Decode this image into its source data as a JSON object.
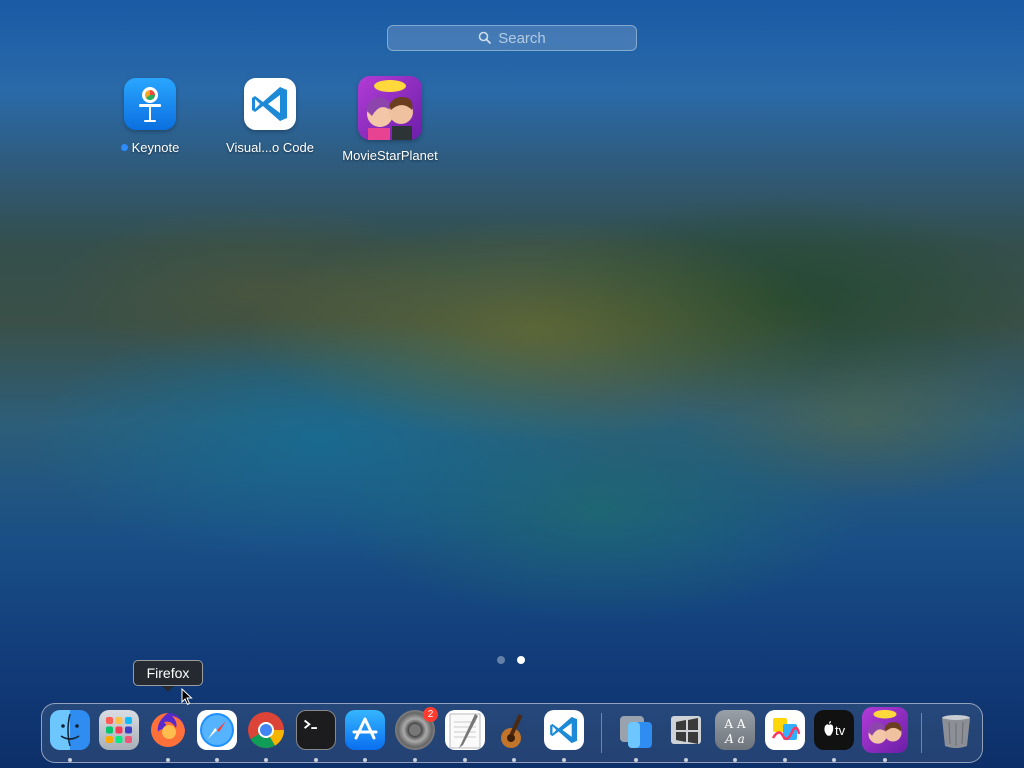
{
  "search": {
    "placeholder": "Search"
  },
  "apps": [
    {
      "label": "Keynote",
      "icon": "keynote-icon",
      "new": true
    },
    {
      "label": "Visual...o Code",
      "icon": "vscode-icon"
    },
    {
      "label": "MovieStarPlanet",
      "icon": "moviestarplanet-icon"
    }
  ],
  "pager": {
    "pages": 2,
    "current": 2
  },
  "tooltip": {
    "text": "Firefox"
  },
  "dock": {
    "items": [
      {
        "name": "Finder",
        "icon": "finder-icon",
        "running": true
      },
      {
        "name": "Launchpad",
        "icon": "launchpad-icon",
        "running": false
      },
      {
        "name": "Firefox",
        "icon": "firefox-icon",
        "running": true
      },
      {
        "name": "Safari",
        "icon": "safari-icon",
        "running": true
      },
      {
        "name": "Google Chrome",
        "icon": "chrome-icon",
        "running": true
      },
      {
        "name": "Terminal",
        "icon": "terminal-icon",
        "running": true
      },
      {
        "name": "App Store",
        "icon": "app-store-icon",
        "running": true
      },
      {
        "name": "System Settings",
        "icon": "system-settings-icon",
        "running": true,
        "badge": "2"
      },
      {
        "name": "TextEdit",
        "icon": "textedit-icon",
        "running": true
      },
      {
        "name": "GarageBand",
        "icon": "garageband-icon",
        "running": true
      },
      {
        "name": "Visual Studio Code",
        "icon": "vscode-icon",
        "running": true
      },
      {
        "name": "Finder Utility",
        "icon": "migration-assistant-icon",
        "running": true
      },
      {
        "name": "Boot Camp",
        "icon": "boot-camp-icon",
        "running": true
      },
      {
        "name": "Font Book",
        "icon": "font-book-icon",
        "running": true
      },
      {
        "name": "Freeform",
        "icon": "freeform-icon",
        "running": true
      },
      {
        "name": "Apple TV",
        "icon": "apple-tv-icon",
        "running": true
      },
      {
        "name": "MovieStarPlanet",
        "icon": "moviestarplanet-icon",
        "running": true
      },
      {
        "name": "Trash",
        "icon": "trash-icon",
        "running": false
      }
    ]
  },
  "tv_text": "tv"
}
